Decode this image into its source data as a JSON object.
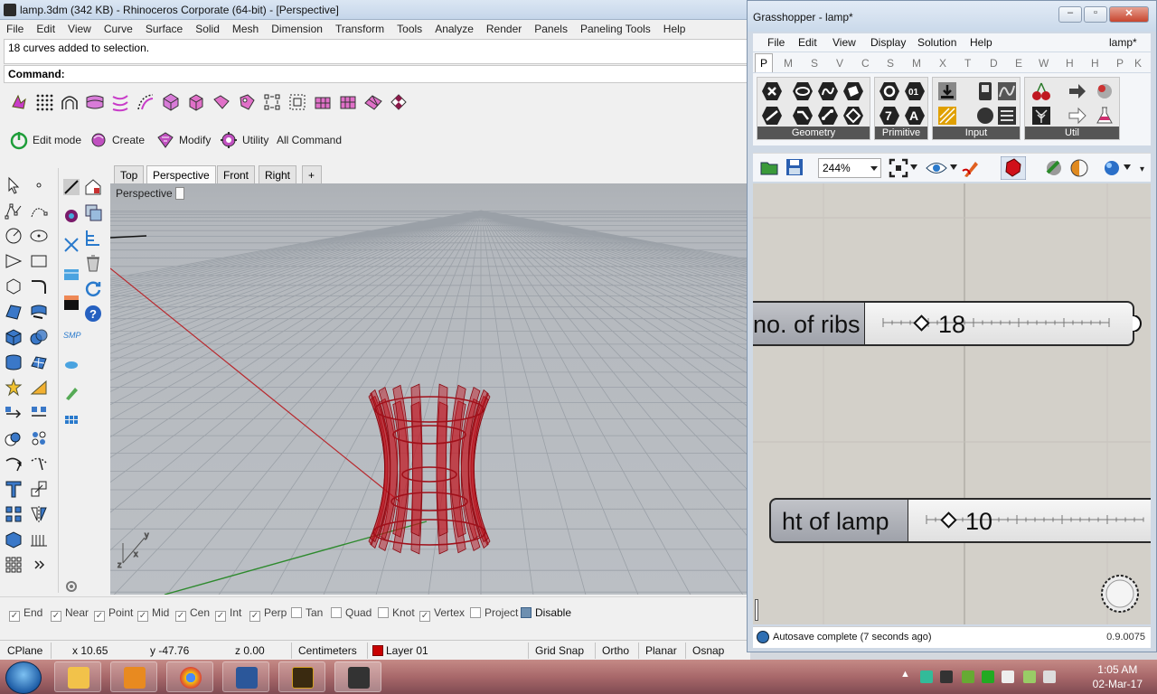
{
  "rhino": {
    "title": "lamp.3dm (342 KB) - Rhinoceros Corporate (64-bit) - [Perspective]",
    "menu": [
      "File",
      "Edit",
      "View",
      "Curve",
      "Surface",
      "Solid",
      "Mesh",
      "Dimension",
      "Transform",
      "Tools",
      "Analyze",
      "Render",
      "Panels",
      "Paneling Tools",
      "Help"
    ],
    "history": "18 curves added to selection.",
    "command": "Command:",
    "toolbar2": [
      "Edit mode",
      "Create",
      "Modify",
      "Utility",
      "All Command"
    ],
    "viewport_tabs": [
      "Top",
      "Perspective",
      "Front",
      "Right"
    ],
    "viewport_add": "+",
    "viewport_label": "Perspective",
    "osnaps": [
      {
        "label": "End",
        "checked": true
      },
      {
        "label": "Near",
        "checked": true
      },
      {
        "label": "Point",
        "checked": true
      },
      {
        "label": "Mid",
        "checked": true
      },
      {
        "label": "Cen",
        "checked": true
      },
      {
        "label": "Int",
        "checked": true
      },
      {
        "label": "Perp",
        "checked": true
      },
      {
        "label": "Tan",
        "checked": false
      },
      {
        "label": "Quad",
        "checked": false
      },
      {
        "label": "Knot",
        "checked": false
      },
      {
        "label": "Vertex",
        "checked": true
      },
      {
        "label": "Project",
        "checked": false
      },
      {
        "label": "Disable",
        "checked": false
      }
    ],
    "status": {
      "cplane": "CPlane",
      "x": "x 10.65",
      "y": "y -47.76",
      "z": "z 0.00",
      "units": "Centimeters",
      "layer": "Layer 01",
      "grid_snap": "Grid Snap",
      "ortho": "Ortho",
      "planar": "Planar",
      "osnap": "Osnap"
    },
    "colors": {
      "geometry": "#c0101a",
      "layer": "#c80000"
    }
  },
  "grasshopper": {
    "title": "Grasshopper - lamp*",
    "menu": [
      "File",
      "Edit",
      "View",
      "Display",
      "Solution",
      "Help"
    ],
    "doc_name": "lamp*",
    "tabs": [
      "P",
      "M",
      "S",
      "V",
      "C",
      "S",
      "M",
      "X",
      "T",
      "D",
      "E",
      "W",
      "H",
      "H",
      "P",
      "K"
    ],
    "ribbon_groups": [
      "Geometry",
      "Primitive",
      "Input",
      "Util"
    ],
    "zoom": "244%",
    "sliders": [
      {
        "label": "no. of ribs",
        "value": "18"
      },
      {
        "label": "ht of lamp",
        "value": "10"
      }
    ],
    "status": "Autosave complete (7 seconds ago)",
    "version": "0.9.0075"
  },
  "taskbar": {
    "time": "1:05 AM",
    "date": "02-Mar-17",
    "apps": [
      "file-explorer",
      "media-player",
      "chrome",
      "word",
      "muse",
      "rhino"
    ]
  }
}
